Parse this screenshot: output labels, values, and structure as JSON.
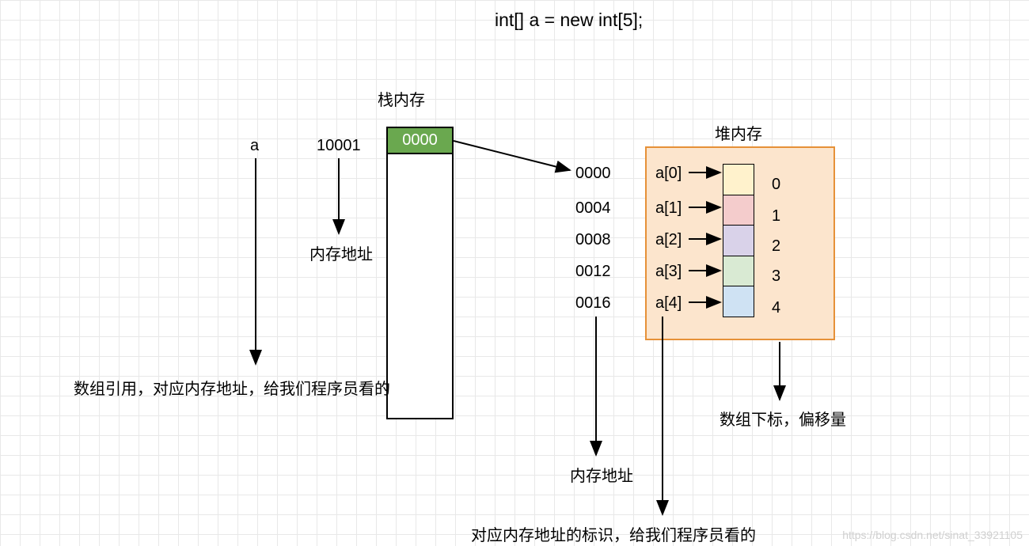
{
  "title": "int[] a = new int[5];",
  "stack": {
    "label": "栈内存",
    "varName": "a",
    "addressLabel": "10001",
    "value": "0000",
    "addressNote": "内存地址",
    "referenceNote": "数组引用，对应内存地址，给我们程序员看的"
  },
  "heap": {
    "label": "堆内存",
    "addresses": [
      "0000",
      "0004",
      "0008",
      "0012",
      "0016"
    ],
    "identifiers": [
      "a[0]",
      "a[1]",
      "a[2]",
      "a[3]",
      "a[4]"
    ],
    "indices": [
      "0",
      "1",
      "2",
      "3",
      "4"
    ],
    "addressNote": "内存地址",
    "identifierNote": "对应内存地址的标识，给我们程序员看的",
    "indexNote": "数组下标，偏移量"
  },
  "watermark": "https://blog.csdn.net/sinat_33921105",
  "chart_data": {
    "type": "table",
    "title": "Java array memory layout (int[] a = new int[5])",
    "stack_entries": [
      {
        "variable": "a",
        "stack_slot_address": "10001",
        "stored_value_heap_base": "0000"
      }
    ],
    "heap_cells": [
      {
        "index": 0,
        "identifier": "a[0]",
        "address": "0000"
      },
      {
        "index": 1,
        "identifier": "a[1]",
        "address": "0004"
      },
      {
        "index": 2,
        "identifier": "a[2]",
        "address": "0008"
      },
      {
        "index": 3,
        "identifier": "a[3]",
        "address": "0012"
      },
      {
        "index": 4,
        "identifier": "a[4]",
        "address": "0016"
      }
    ],
    "int_byte_size": 4
  }
}
